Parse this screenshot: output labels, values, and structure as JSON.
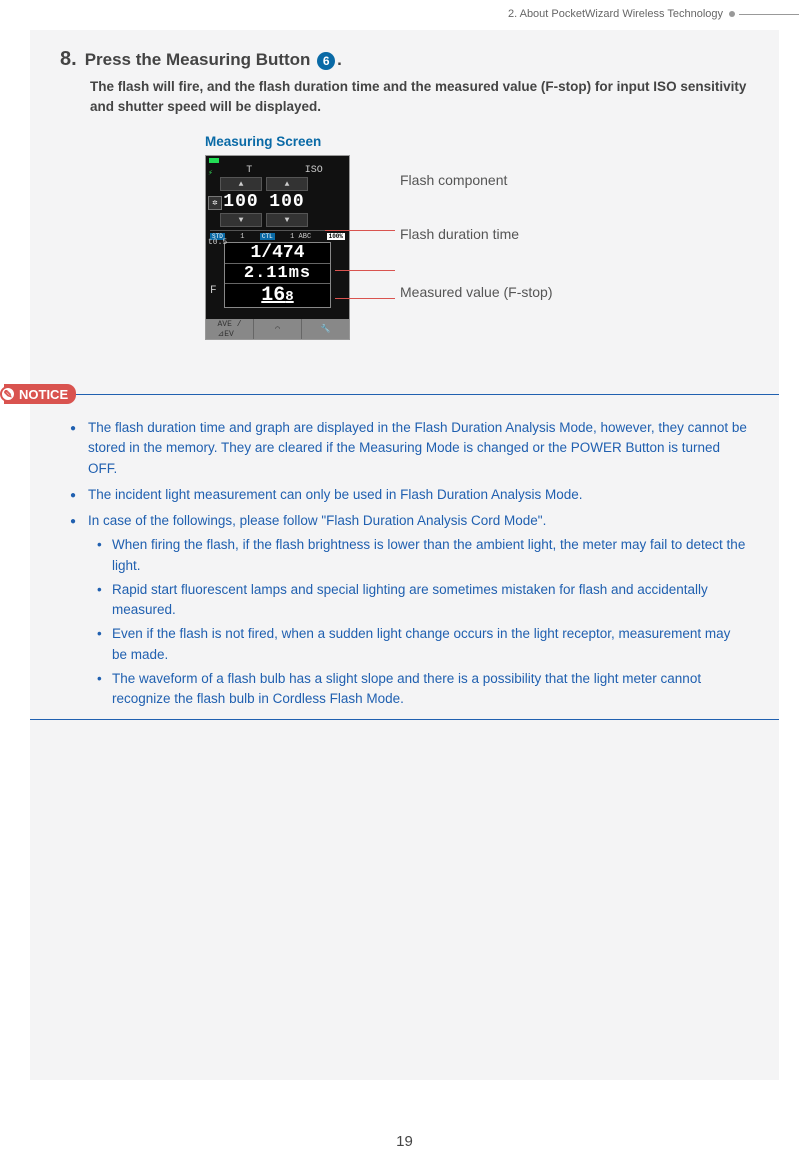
{
  "header": {
    "chapter": "2.  About PocketWizard Wireless Technology"
  },
  "step": {
    "number": "8.",
    "title_pre": "Press the Measuring Button ",
    "ref": "6",
    "title_post": ".",
    "description": "The flash will fire, and the flash duration time and the measured value (F-stop) for input ISO sensitivity and shutter speed will be displayed."
  },
  "figure": {
    "caption": "Measuring Screen",
    "labels": {
      "t": "T",
      "iso": "ISO"
    },
    "values": {
      "t_val": "100",
      "iso_val": "100",
      "std": "STD",
      "one": "1",
      "ctl": "CTL",
      "abc": "1 ABC",
      "pct": "100%",
      "t05": "t0.5",
      "f": "F",
      "line1": "1/474",
      "line2": "2.11ms",
      "line3_main": "16",
      "line3_sub": "8",
      "bottom1": "AVE /",
      "bottom1b": "⊿EV"
    },
    "callouts": {
      "c1": "Flash component",
      "c2": "Flash duration time",
      "c3": "Measured value (F-stop)"
    }
  },
  "notice": {
    "label": "NOTICE",
    "items": [
      "The flash duration time and graph are displayed in the Flash Duration Analysis Mode, however, they cannot be stored in the memory. They are cleared if the Measuring Mode is changed or the POWER Button is turned OFF.",
      "The incident light measurement can only be used in Flash Duration Analysis Mode.",
      "In case of the followings, please follow \"Flash Duration Analysis Cord Mode\"."
    ],
    "subitems": [
      "When firing the flash, if the flash brightness is lower than the ambient light, the meter may fail to detect the light.",
      "Rapid start fluorescent lamps and special lighting are sometimes mistaken for flash and accidentally measured.",
      "Even if the flash is not fired, when a sudden light change occurs in the light receptor, measurement may be made.",
      "The waveform of a flash bulb has a slight slope and there is a possibility that the light meter cannot recognize the flash bulb in Cordless Flash Mode."
    ]
  },
  "page_number": "19"
}
